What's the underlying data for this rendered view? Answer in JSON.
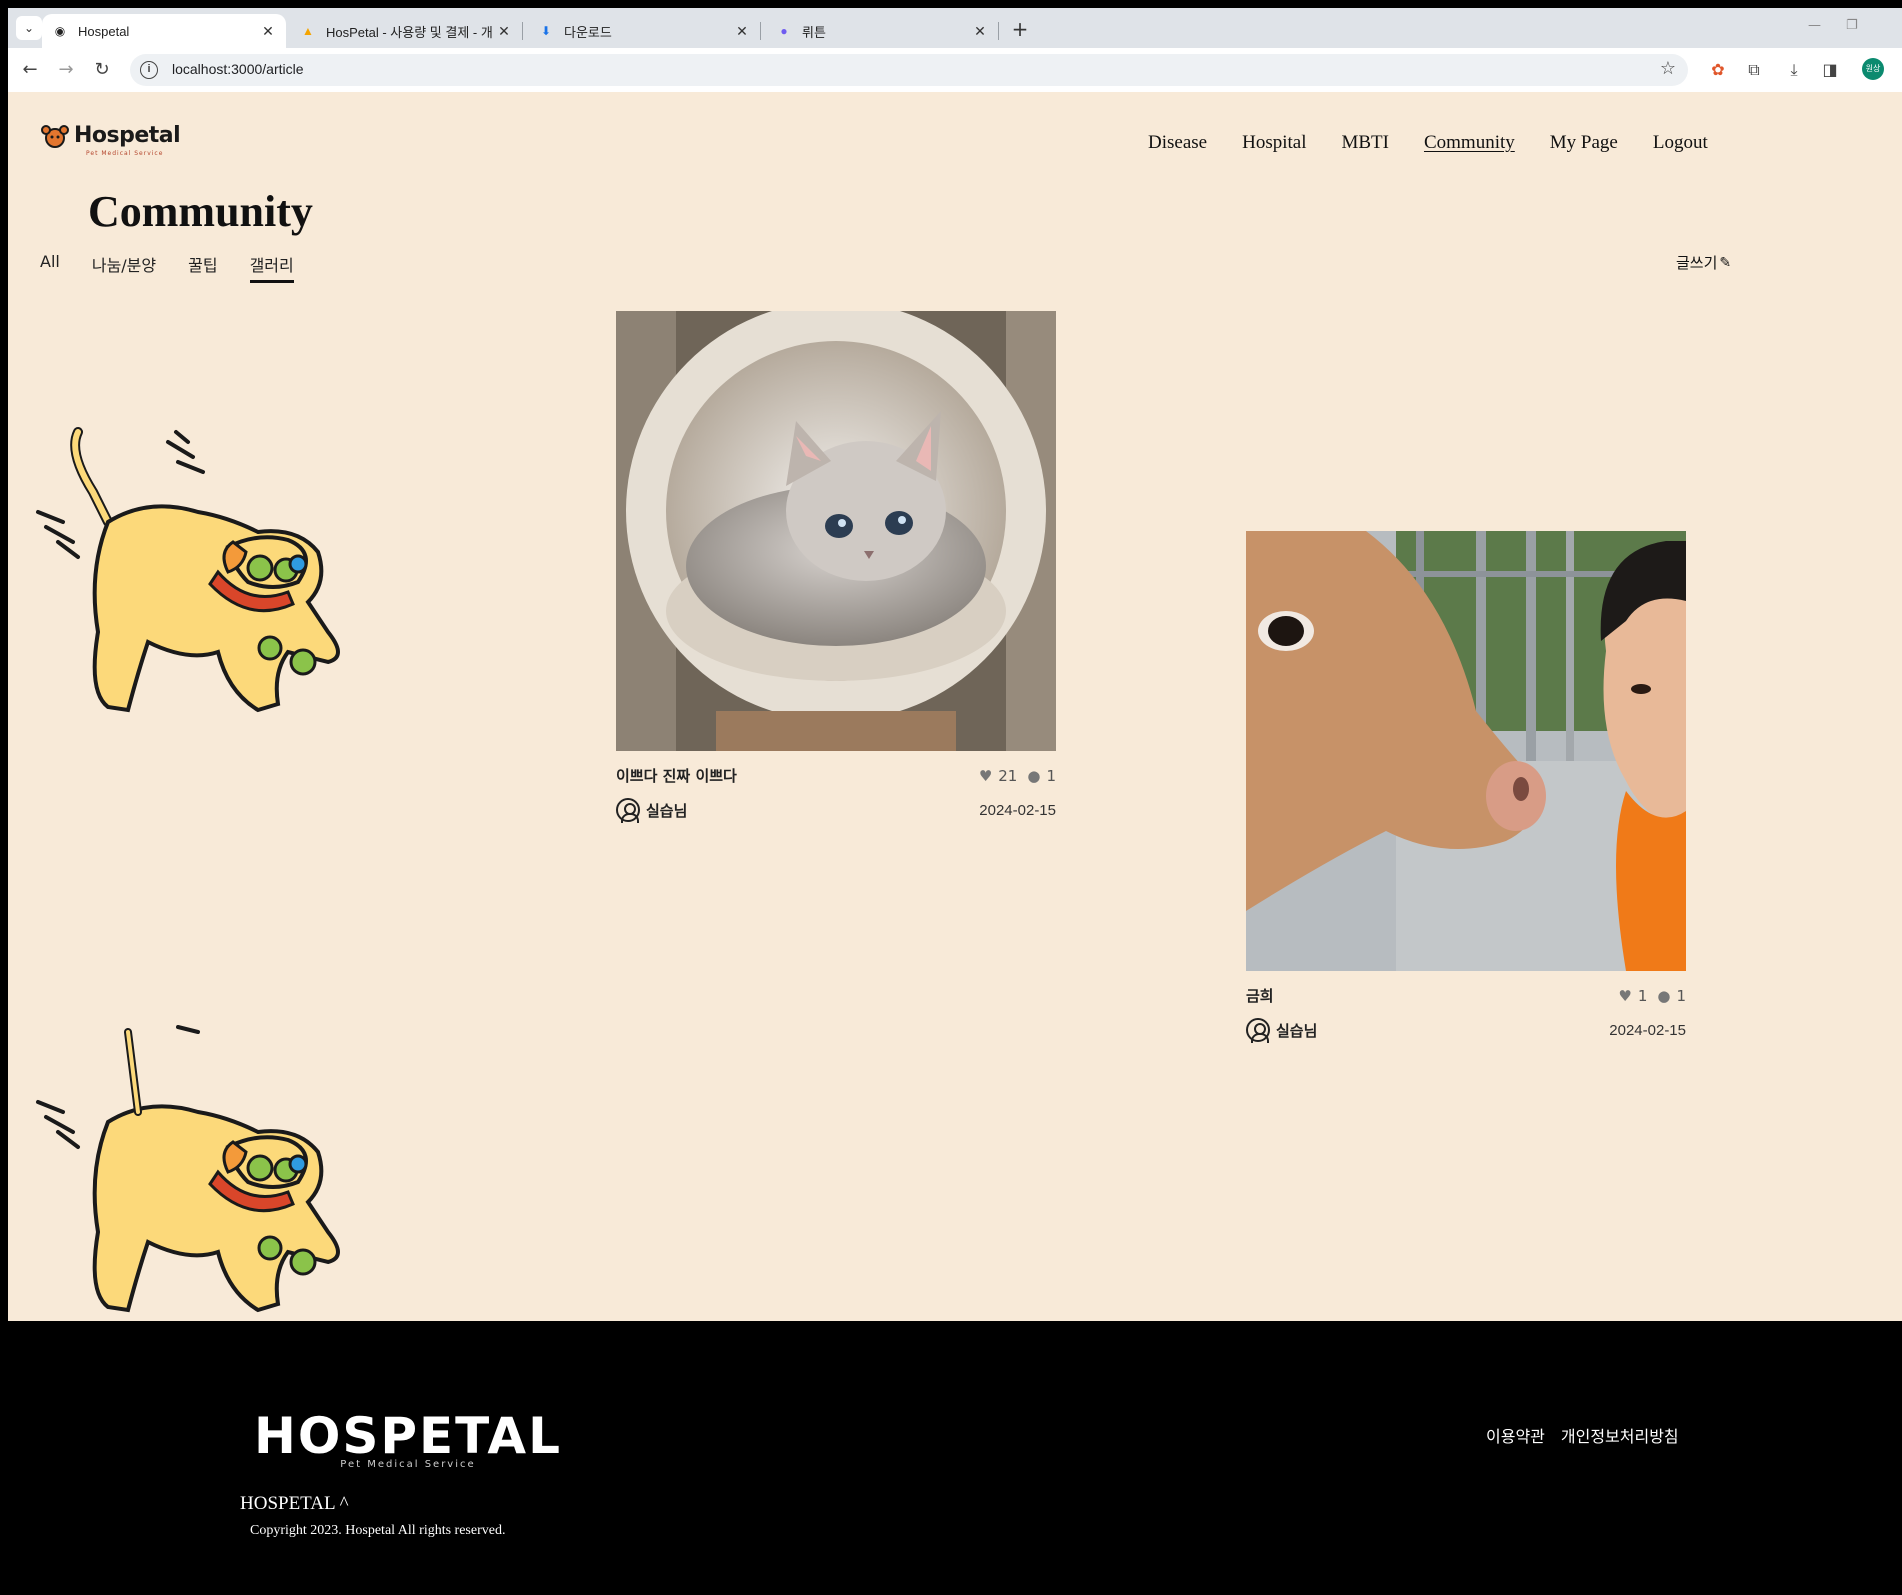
{
  "browser": {
    "tabs": [
      {
        "title": "Hospetal",
        "active": true
      },
      {
        "title": "HosPetal - 사용량 및 결제 - 개",
        "active": false
      },
      {
        "title": "다운로드",
        "active": false
      },
      {
        "title": "뤼튼",
        "active": false
      }
    ],
    "url": "localhost:3000/article",
    "profile_initials": "원상"
  },
  "header": {
    "logo_text": "Hospetal",
    "logo_sub": "Pet Medical Service",
    "nav": [
      "Disease",
      "Hospital",
      "MBTI",
      "Community",
      "My Page",
      "Logout"
    ],
    "current_nav": "Community"
  },
  "page": {
    "title": "Community",
    "categories": [
      "All",
      "나눔/분양",
      "꿀팁",
      "갤러리"
    ],
    "selected_category": "갤러리",
    "write_label": "글쓰기"
  },
  "posts": [
    {
      "title": "이쁘다 진짜 이쁘다",
      "likes": "21",
      "comments": "1",
      "author": "실습님",
      "date": "2024-02-15",
      "image": "kitten"
    },
    {
      "title": "금희",
      "likes": "1",
      "comments": "1",
      "author": "실습님",
      "date": "2024-02-15",
      "image": "calf-selfie"
    }
  ],
  "footer": {
    "logo_text": "HOSPETAL",
    "logo_sub": "Pet Medical Service",
    "brand": "HOSPETAL ^",
    "copyright": "Copyright 2023. Hospetal All rights reserved.",
    "links": [
      "이용약관",
      "개인정보처리방침"
    ]
  },
  "colors": {
    "page_bg": "#f8ead8",
    "footer_bg": "#000000",
    "dog_body": "#fcd97a",
    "dog_collar": "#d9462a"
  }
}
